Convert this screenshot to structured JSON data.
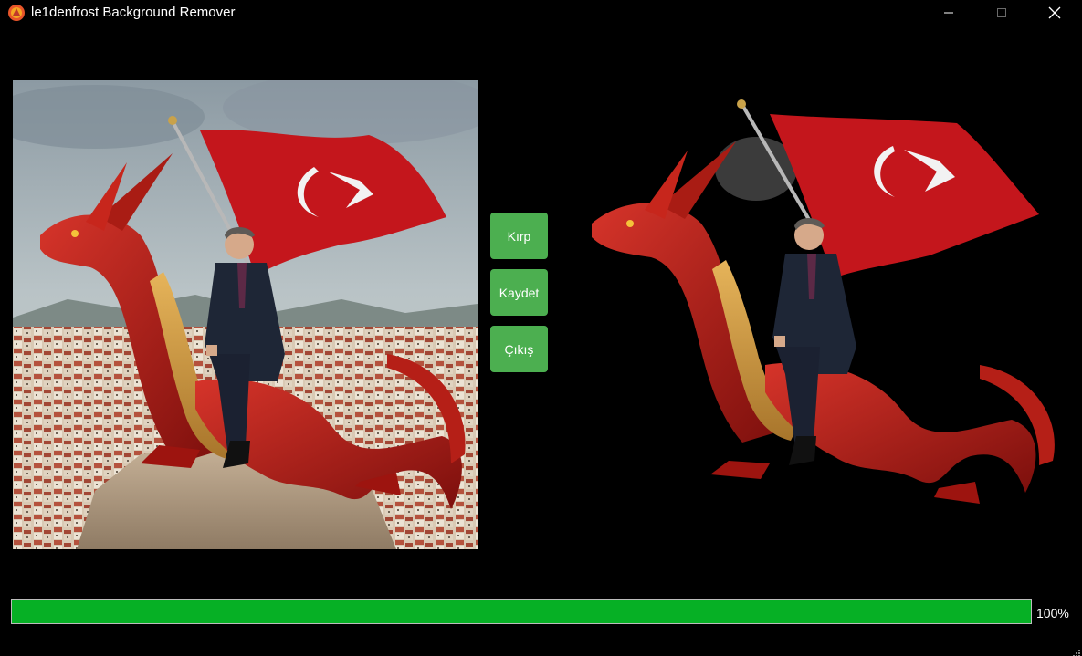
{
  "window": {
    "title": "le1denfrost Background Remover"
  },
  "icons": {
    "app": "app-logo-icon",
    "minimize": "minimize-icon",
    "maximize": "maximize-icon",
    "close": "close-icon",
    "grip": "resize-grip-icon"
  },
  "buttons": {
    "crop_label": "Kırp",
    "save_label": "Kaydet",
    "exit_label": "Çıkış"
  },
  "progress": {
    "value": 1.0,
    "label": "100%"
  },
  "colors": {
    "button_green": "#4caf50",
    "progress_green": "#06b025",
    "background": "#000000"
  }
}
